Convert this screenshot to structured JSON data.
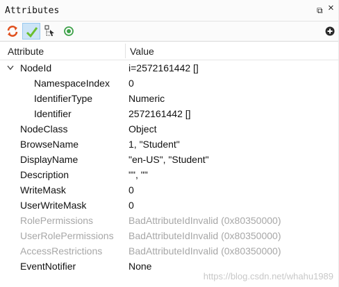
{
  "window": {
    "title": "Attributes",
    "float_glyph": "⧉",
    "close_glyph": "×"
  },
  "toolbar": {
    "icons": [
      "refresh-icon",
      "check-icon",
      "tree-icon",
      "radio-icon"
    ],
    "add_icon": "add-icon"
  },
  "table": {
    "headers": [
      "Attribute",
      "Value"
    ],
    "rows": [
      {
        "name": "NodeId",
        "value": "i=2572161442 []",
        "level": 0,
        "expanded": true,
        "disabled": false
      },
      {
        "name": "NamespaceIndex",
        "value": "0",
        "level": 1,
        "disabled": false
      },
      {
        "name": "IdentifierType",
        "value": "Numeric",
        "level": 1,
        "disabled": false
      },
      {
        "name": "Identifier",
        "value": "2572161442 []",
        "level": 1,
        "disabled": false
      },
      {
        "name": "NodeClass",
        "value": "Object",
        "level": 0,
        "disabled": false
      },
      {
        "name": "BrowseName",
        "value": "1, \"Student\"",
        "level": 0,
        "disabled": false
      },
      {
        "name": "DisplayName",
        "value": "\"en-US\", \"Student\"",
        "level": 0,
        "disabled": false
      },
      {
        "name": "Description",
        "value": "\"\", \"\"",
        "level": 0,
        "disabled": false
      },
      {
        "name": "WriteMask",
        "value": "0",
        "level": 0,
        "disabled": false
      },
      {
        "name": "UserWriteMask",
        "value": "0",
        "level": 0,
        "disabled": false
      },
      {
        "name": "RolePermissions",
        "value": "BadAttributeIdInvalid (0x80350000)",
        "level": 0,
        "disabled": true
      },
      {
        "name": "UserRolePermissions",
        "value": "BadAttributeIdInvalid (0x80350000)",
        "level": 0,
        "disabled": true
      },
      {
        "name": "AccessRestrictions",
        "value": "BadAttributeIdInvalid (0x80350000)",
        "level": 0,
        "disabled": true
      },
      {
        "name": "EventNotifier",
        "value": "None",
        "level": 0,
        "disabled": false
      }
    ]
  },
  "watermark": "https://blog.csdn.net/whahu1989"
}
